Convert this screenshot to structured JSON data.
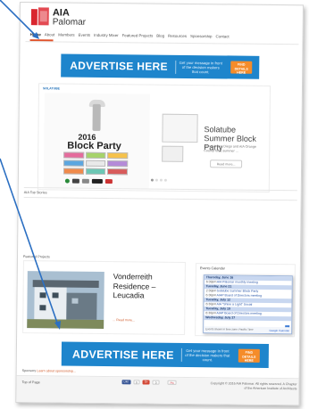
{
  "site": {
    "name_line1": "AIA",
    "name_line2": "Palomar"
  },
  "nav": {
    "items": [
      "Home",
      "About",
      "Members",
      "Events",
      "Industry Mixer",
      "Featured Projects",
      "Blog",
      "Resources",
      "Sponsorship",
      "Contact"
    ],
    "active": "Home"
  },
  "ad": {
    "headline_light": "ADVERTISE",
    "headline_bold": "HERE",
    "message": "Get your message in front of the decision makers that count.",
    "cta": "FIND DETAILS HERE"
  },
  "slider": {
    "tag": "SOLATUBE",
    "poster_year": "2016",
    "poster_title": "Block Party",
    "title": "Solatube Summer Block Party",
    "description": "Join AIA San Diego and AIA Orange County for a summer ...",
    "button": "Read more..."
  },
  "sections": {
    "top_stories": "AIA Top Stories",
    "featured": "Featured Projects",
    "events": "Events Calendar"
  },
  "featured": {
    "title": "Vonderreith Residence – Leucadia",
    "more": "... Read more..."
  },
  "calendar": {
    "header": "Events Calendar",
    "rows": [
      {
        "type": "day",
        "text": "Thursday, June 16"
      },
      {
        "type": "event",
        "time": "6:30pm",
        "text": "AIA Palomar monthly meeting"
      },
      {
        "type": "day",
        "text": "Tuesday, June 21"
      },
      {
        "type": "event",
        "time": "2:30pm",
        "text": "Solatube Summer Block Party"
      },
      {
        "type": "event",
        "time": "6:30pm",
        "text": "AIAP Board of Directors meeting"
      },
      {
        "type": "day",
        "text": "Tuesday, July 12"
      },
      {
        "type": "event",
        "time": "6:30pm",
        "text": "AIA \"Shine a Light\" Social"
      },
      {
        "type": "day",
        "text": "Tuesday, July 19"
      },
      {
        "type": "event",
        "time": "6:30pm",
        "text": "AIAP Board of Directors meeting"
      },
      {
        "type": "day",
        "text": "Wednesday, July 27"
      }
    ],
    "footer": "Events shown in time zone: Pacific Time",
    "gcal": "Google Calendar",
    "plus": "+"
  },
  "sponsor": {
    "label": "Sponsors",
    "link": "Learn about sponsorship..."
  },
  "footer": {
    "top": "Top of Page",
    "share": [
      "Like",
      "0",
      "G+",
      "0",
      "Pin"
    ],
    "copyright": "Copyright © 2016 AIA Palomar. All rights reserved. A Chapter of the American Institute of Architects"
  },
  "colors": {
    "accent": "#e0522a",
    "ad_blue": "#1e85cc",
    "cta_orange": "#f58c2a",
    "arrow_blue": "#2b6fc2"
  },
  "icons": [
    "aia-logo-icon",
    "solatube-poster",
    "house-photo",
    "google-calendar-plus-icon",
    "callout-arrow"
  ]
}
